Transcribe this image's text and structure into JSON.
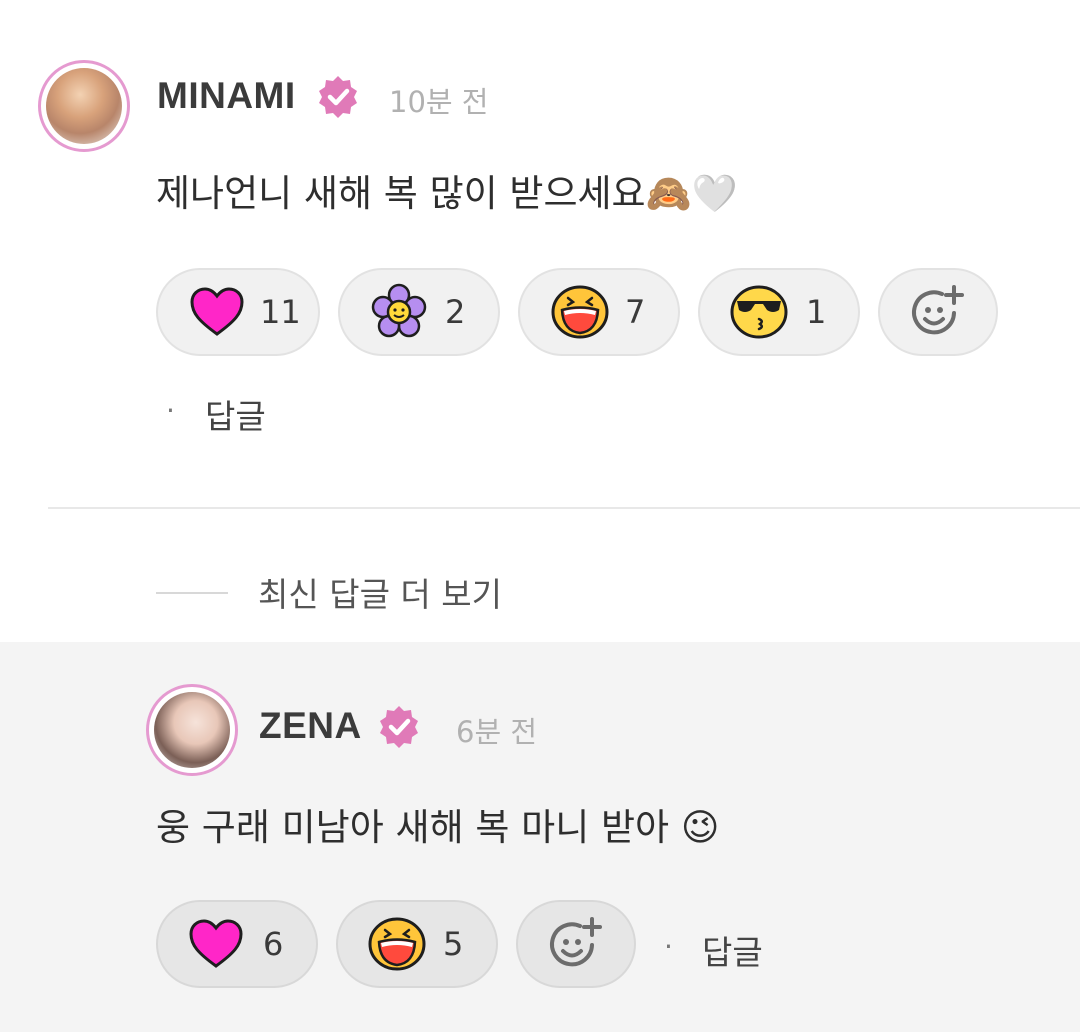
{
  "comment": {
    "author": "MINAMI",
    "time": "10분 전",
    "text": "제나언니 새해 복 많이 받으세요🙈🤍",
    "reactions": [
      {
        "icon": "pink-heart-icon",
        "count": "11"
      },
      {
        "icon": "purple-flower-icon",
        "count": "2"
      },
      {
        "icon": "laughing-face-icon",
        "count": "7"
      },
      {
        "icon": "sunglasses-kiss-face-icon",
        "count": "1"
      }
    ],
    "reply_label": "답글"
  },
  "more_replies_label": "최신 답글 더 보기",
  "reply": {
    "author": "ZENA",
    "time": "6분 전",
    "text": "웅 구래 미남아 새해 복 마니 받아 😉",
    "reactions": [
      {
        "icon": "pink-heart-icon",
        "count": "6"
      },
      {
        "icon": "laughing-face-icon",
        "count": "5"
      }
    ],
    "reply_label": "답글"
  },
  "colors": {
    "accent_pink": "#e59ad0",
    "verified_badge": "#e07ab8",
    "heart": "#ff26c8",
    "reply_bg": "#f4f4f4"
  }
}
